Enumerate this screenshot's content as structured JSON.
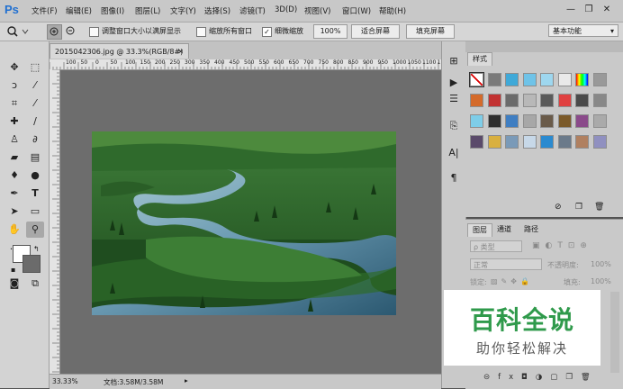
{
  "app": {
    "logo": "Ps"
  },
  "menu": [
    "文件(F)",
    "编辑(E)",
    "图像(I)",
    "图层(L)",
    "文字(Y)",
    "选择(S)",
    "滤镜(T)",
    "3D(D)",
    "视图(V)",
    "窗口(W)",
    "帮助(H)"
  ],
  "window_controls": {
    "minimize": "—",
    "restore": "❐",
    "close": "✕"
  },
  "options": {
    "resize_windows_label": "调整窗口大小以满屏显示",
    "zoom_all_label": "缩放所有窗口",
    "scrubby_zoom_label": "细微缩放",
    "zoom_value": "100%",
    "fit_screen_label": "适合屏幕",
    "fill_screen_label": "填充屏幕",
    "workspace": "基本功能",
    "resize_windows_checked": false,
    "zoom_all_checked": false,
    "scrubby_zoom_checked": true
  },
  "document": {
    "tab_title": "2015042306.jpg @ 33.3%(RGB/8#)",
    "tab_close": "✕",
    "ruler_ticks": [
      "100",
      "50",
      "0",
      "50",
      "100",
      "150",
      "200",
      "250",
      "300",
      "350",
      "400",
      "450",
      "500",
      "550",
      "600",
      "650",
      "700",
      "750",
      "800",
      "850",
      "900",
      "950",
      "1000",
      "1050",
      "1100",
      "1150"
    ]
  },
  "status": {
    "zoom": "33.33%",
    "doc_size": "文档:3.58M/3.58M"
  },
  "styles_panel": {
    "title": "样式"
  },
  "layers_panel": {
    "tabs": [
      "图层",
      "通道",
      "路径"
    ],
    "filter_kind": "ρ 类型",
    "blend_mode": "正常",
    "opacity_label": "不透明度:",
    "opacity_value": "100%",
    "lock_label": "锁定:",
    "fill_label": "填充:",
    "fill_value": "100%"
  },
  "watermark": {
    "title": "百科全说",
    "subtitle": "助你轻松解决"
  },
  "colors": {
    "accent": "#1f6fd1",
    "watermark_green": "#2f9a4b",
    "canvas_bg": "#6d6d6d"
  }
}
